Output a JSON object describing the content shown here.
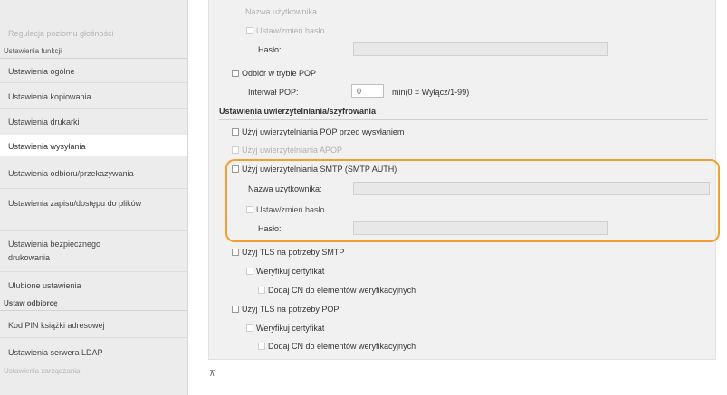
{
  "sidebar": {
    "items": [
      {
        "label": "Regulacja poziomu głośności",
        "kind": "dim"
      },
      {
        "label": "Ustawienia funkcji",
        "kind": "head"
      },
      {
        "label": "Ustawienia ogólne",
        "kind": "item"
      },
      {
        "label": "Ustawienia kopiowania",
        "kind": "item"
      },
      {
        "label": "Ustawienia drukarki",
        "kind": "item"
      },
      {
        "label": "Ustawienia wysyłania",
        "kind": "selected"
      },
      {
        "label": "Ustawienia odbioru/przekazywania",
        "kind": "item"
      },
      {
        "label": "Ustawienia zapisu/dostępu do plików",
        "kind": "item"
      },
      {
        "label": "Ustawienia bezpiecznego drukowania",
        "kind": "item"
      },
      {
        "label": "Ulubione ustawienia",
        "kind": "item"
      },
      {
        "label": "Ustaw odbiorcę",
        "kind": "head"
      },
      {
        "label": "Kod PIN książki adresowej",
        "kind": "item"
      },
      {
        "label": "Ustawienia serwera LDAP",
        "kind": "item"
      },
      {
        "label": "Ustawienia zarządzania",
        "kind": "dimhead"
      }
    ]
  },
  "main": {
    "top_faded": "Nazwa użytkownika",
    "set_change_pw_1": "Ustaw/zmień hasło",
    "password_1": "Hasło:",
    "pop_rx": "Odbiór w trybie POP",
    "pop_interval_label": "Interwał POP:",
    "pop_interval_value": "0",
    "pop_interval_unit": "min(0 = Wyłącz/1-99)",
    "auth_section_title": "Ustawienia uwierzytelniania/szyfrowania",
    "use_pop_before_send": "Użyj uwierzytelniania POP przed wysyłaniem",
    "use_apop": "Użyj uwierzytelniania APOP",
    "use_smtp_auth": "Użyj uwierzytelniania SMTP (SMTP AUTH)",
    "smtp_username_label": "Nazwa użytkownika:",
    "set_change_pw_2": "Ustaw/zmień hasło",
    "password_2": "Hasło:",
    "tls_smtp": "Użyj TLS na potrzeby SMTP",
    "verify_cert_1": "Weryfikuj certyfikat",
    "add_cn_1": "Dodaj CN do elementów weryfikacyjnych",
    "tls_pop": "Użyj TLS na potrzeby POP",
    "verify_cert_2": "Weryfikuj certyfikat",
    "add_cn_2": "Dodaj CN do elementów weryfikacyjnych",
    "scroll_top_icon": "scroll-to-top-icon",
    "scroll_top_glyph": "⊼"
  },
  "colors": {
    "highlight": "#f0a030",
    "sidebar_bg": "#ececec",
    "panel_bg": "#f1f1f1"
  }
}
